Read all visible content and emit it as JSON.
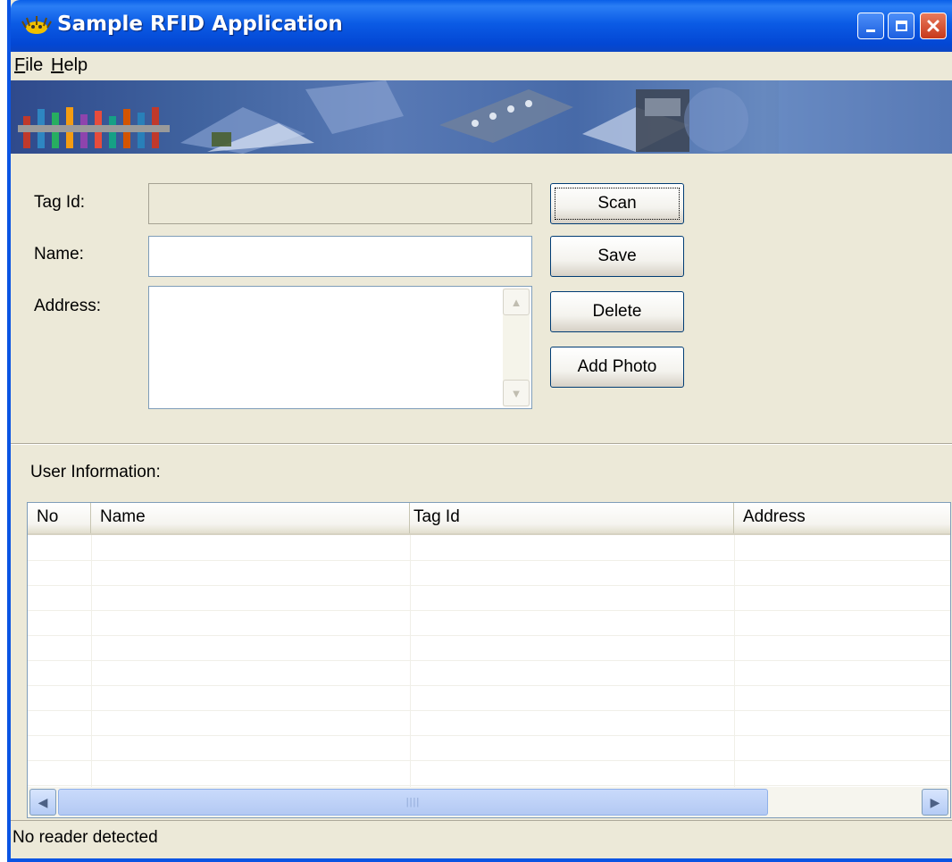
{
  "window": {
    "title": "Sample RFID Application",
    "accent": "#0a54e3"
  },
  "menu": {
    "items": [
      {
        "label": "File",
        "mnemonic": "F"
      },
      {
        "label": "Help",
        "mnemonic": "H"
      }
    ]
  },
  "form": {
    "tag_id_label": "Tag Id:",
    "tag_id_value": "",
    "name_label": "Name:",
    "name_value": "",
    "address_label": "Address:",
    "address_value": ""
  },
  "buttons": {
    "scan": "Scan",
    "save": "Save",
    "delete": "Delete",
    "add_photo": "Add Photo"
  },
  "list": {
    "title": "User Information:",
    "columns": [
      "No",
      "Name",
      "Tag Id",
      "Address"
    ],
    "rows": []
  },
  "status": {
    "text": "No reader detected"
  }
}
